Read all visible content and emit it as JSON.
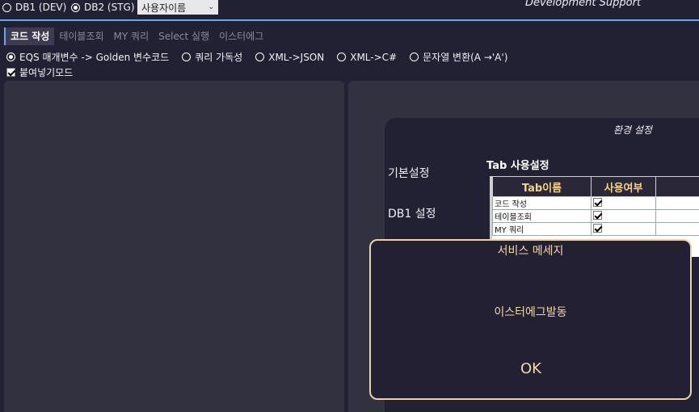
{
  "db": {
    "db1_label": "DB1 (DEV)",
    "db2_label": "DB2 (STG)",
    "user_select_value": "사용자이름"
  },
  "header": {
    "subtitle": "Development Support"
  },
  "tabs": [
    "코드 작성",
    "테이블조회",
    "MY 쿼리",
    "Select 실행",
    "이스터에그"
  ],
  "modes": [
    "EQS 매개변수 -> Golden 변수코드",
    "쿼리 가독성",
    "XML->JSON",
    "XML->C#",
    "문자열 변환(A →'A')"
  ],
  "paste_mode_label": "붙여넣기모드",
  "settings": {
    "title": "환경 설정",
    "nav": [
      "기본설정",
      "DB1 설정"
    ],
    "tab_section_title": "Tab 사용설정",
    "col_tab_name": "Tab이름",
    "col_use": "사용여부",
    "rows": [
      "코드 작성",
      "테이블조회",
      "MY 쿼리"
    ]
  },
  "dialog": {
    "title": "서비스 메세지",
    "message": "이스터에그발동",
    "ok": "OK"
  },
  "colors": {
    "background": "#222033",
    "panel": "#323140",
    "dialog_border": "#e8d2a6",
    "accent_line": "#6ea7e0"
  }
}
